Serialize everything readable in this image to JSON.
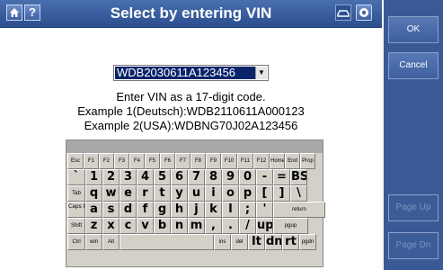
{
  "titlebar": {
    "title": "Select by entering VIN",
    "icons": [
      "home-icon",
      "help-icon",
      "vehicle-icon",
      "settings-icon"
    ],
    "help_glyph": "?"
  },
  "vin_field": {
    "value": "WDB2030611A123456",
    "arrow": "▼"
  },
  "instructions": {
    "line1": "Enter VIN as a 17-digit code.",
    "line2": "Example 1(Deutsch):WDB2110611A000123",
    "line3": "Example 2(USA):WDBNG70J02A123456"
  },
  "keyboard": {
    "rows": [
      [
        "Esc",
        "F1",
        "F2",
        "F3",
        "F4",
        "F5",
        "F6",
        "F7",
        "F8",
        "F9",
        "F10",
        "F11",
        "F12",
        "Home",
        "End",
        "Prop"
      ],
      [
        "`",
        "1",
        "2",
        "3",
        "4",
        "5",
        "6",
        "7",
        "8",
        "9",
        "0",
        "-",
        "=",
        "BS"
      ],
      [
        "Tab",
        "q",
        "w",
        "e",
        "r",
        "t",
        "y",
        "u",
        "i",
        "o",
        "p",
        "[",
        "]",
        "\\"
      ],
      [
        "Caps Lock",
        "a",
        "s",
        "d",
        "f",
        "g",
        "h",
        "j",
        "k",
        "l",
        ";",
        "'",
        "return"
      ],
      [
        "Shift",
        "z",
        "x",
        "c",
        "v",
        "b",
        "n",
        "m",
        ",",
        ".",
        "/",
        "up",
        "pgup"
      ],
      [
        "Ctrl",
        "win",
        "Alt",
        "",
        "ins",
        "del",
        "lt",
        "dn",
        "rt",
        "pgdn"
      ]
    ]
  },
  "sidebar": {
    "ok": "OK",
    "cancel": "Cancel",
    "page_up": "Page Up",
    "page_dn": "Page Dn"
  },
  "colors": {
    "title_bar": "#2c4f8e",
    "sidebar": "#3a5a96",
    "selection": "#0a246a"
  }
}
